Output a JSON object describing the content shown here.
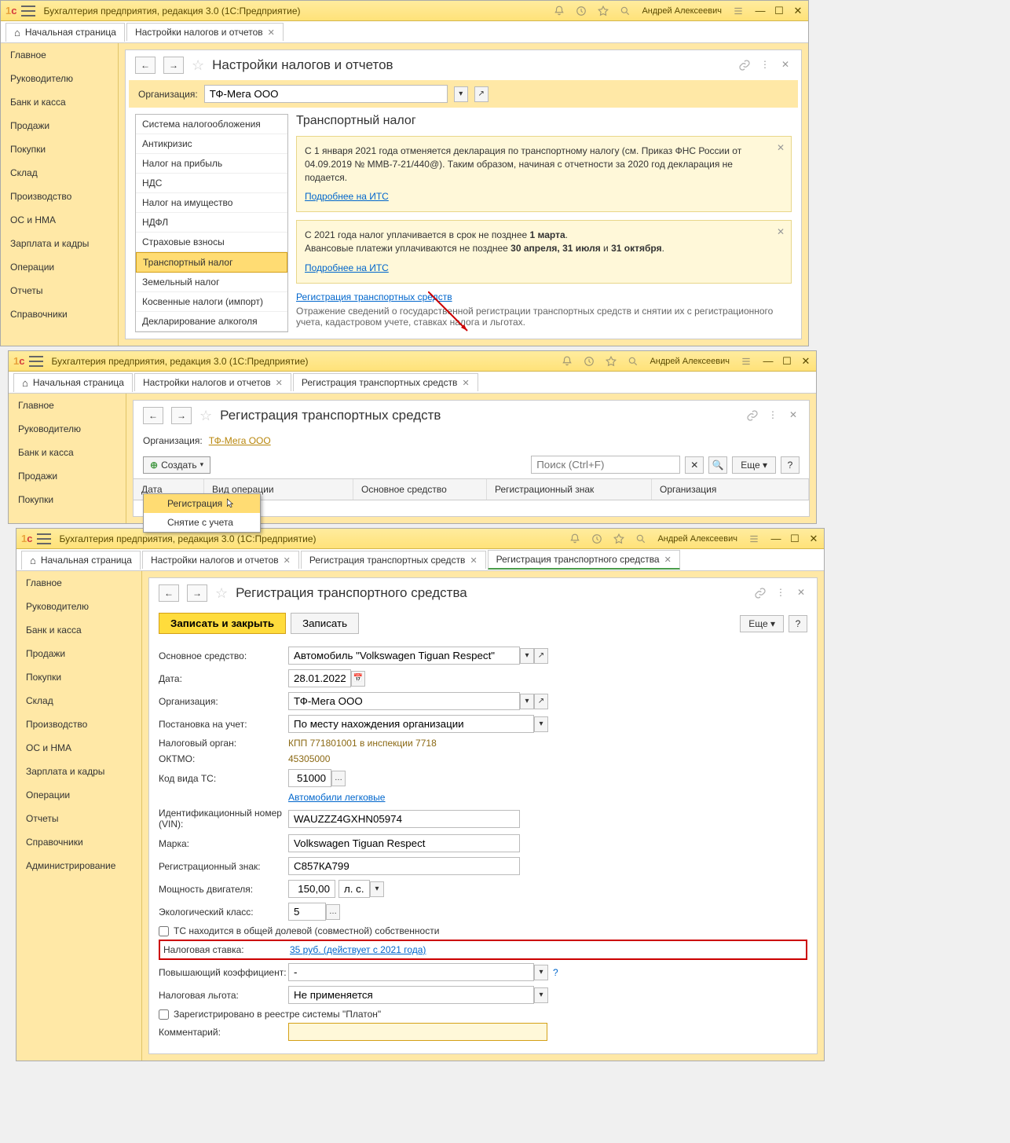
{
  "win1": {
    "title": "Бухгалтерия предприятия, редакция 3.0  (1С:Предприятие)",
    "user": "Андрей Алексеевич",
    "tabs": {
      "home": "Начальная страница",
      "t1": "Настройки налогов и отчетов"
    },
    "page_title": "Настройки налогов и отчетов",
    "org_label": "Организация:",
    "org_value": "ТФ-Мега ООО",
    "leftnav": [
      "Система налогообложения",
      "Антикризис",
      "Налог на прибыль",
      "НДС",
      "Налог на имущество",
      "НДФЛ",
      "Страховые взносы",
      "Транспортный налог",
      "Земельный налог",
      "Косвенные налоги (импорт)",
      "Декларирование алкоголя"
    ],
    "section_title": "Транспортный налог",
    "note1_a": "С 1 января 2021 года отменяется декларация по транспортному налогу (см. Приказ ФНС России от 04.09.2019 № ММВ-7-21/440@). Таким образом, начиная с отчетности за 2020 год декларация не подается.",
    "note1_link": "Подробнее на ИТС",
    "note2_a": "С 2021 года налог уплачивается в срок не позднее ",
    "note2_b": "1 марта",
    "note2_c": "Авансовые платежи уплачиваются не позднее ",
    "note2_d": "30 апреля, 31 июля",
    "note2_e": " и ",
    "note2_f": "31 октября",
    "note2_link": "Подробнее на ИТС",
    "reg_link": "Регистрация транспортных средств",
    "reg_desc": "Отражение сведений о государственной регистрации транспортных средств и снятии их с регистрационного учета, кадастровом учете, ставках налога и льготах."
  },
  "sidebar_items": [
    "Главное",
    "Руководителю",
    "Банк и касса",
    "Продажи",
    "Покупки",
    "Склад",
    "Производство",
    "ОС и НМА",
    "Зарплата и кадры",
    "Операции",
    "Отчеты",
    "Справочники",
    "Администрирование"
  ],
  "win2": {
    "title": "Бухгалтерия предприятия, редакция 3.0  (1С:Предприятие)",
    "user": "Андрей Алексеевич",
    "tabs": {
      "home": "Начальная страница",
      "t1": "Настройки налогов и отчетов",
      "t2": "Регистрация транспортных средств"
    },
    "page_title": "Регистрация транспортных средств",
    "org_label": "Организация:",
    "org_value": "ТФ-Мега ООО",
    "create": "Создать",
    "menu_reg": "Регистрация",
    "menu_unreg": "Снятие с учета",
    "search_ph": "Поиск (Ctrl+F)",
    "more": "Еще",
    "columns": [
      "Дата",
      "Вид операции",
      "Основное средство",
      "Регистрационный знак",
      "Организация"
    ]
  },
  "win3": {
    "title": "Бухгалтерия предприятия, редакция 3.0  (1С:Предприятие)",
    "user": "Андрей Алексеевич",
    "tabs": {
      "home": "Начальная страница",
      "t1": "Настройки налогов и отчетов",
      "t2": "Регистрация транспортных средств",
      "t3": "Регистрация транспортного средства"
    },
    "page_title": "Регистрация транспортного средства",
    "save_close": "Записать и закрыть",
    "save": "Записать",
    "more": "Еще",
    "fields": {
      "asset_l": "Основное средство:",
      "asset_v": "Автомобиль \"Volkswagen Tiguan Respect\"",
      "date_l": "Дата:",
      "date_v": "28.01.2022",
      "org_l": "Организация:",
      "org_v": "ТФ-Мега ООО",
      "reg_l": "Постановка на учет:",
      "reg_v": "По месту нахождения организации",
      "tax_auth_l": "Налоговый орган:",
      "tax_auth_v": "КПП 771801001 в инспекции 7718",
      "oktmo_l": "ОКТМО:",
      "oktmo_v": "45305000",
      "code_l": "Код вида ТС:",
      "code_v": "51000",
      "code_link": "Автомобили легковые",
      "vin_l": "Идентификационный номер (VIN):",
      "vin_v": "WAUZZZ4GXHN05974",
      "brand_l": "Марка:",
      "brand_v": "Volkswagen Tiguan Respect",
      "plate_l": "Регистрационный знак:",
      "plate_v": "С857КА799",
      "power_l": "Мощность двигателя:",
      "power_v": "150,00",
      "power_unit": "л. с.",
      "eco_l": "Экологический класс:",
      "eco_v": "5",
      "shared_cb": "ТС находится в общей долевой (совместной) собственности",
      "rate_l": "Налоговая ставка:",
      "rate_v": "35 руб. (действует с 2021 года)",
      "coef_l": "Повышающий коэффициент:",
      "coef_v": "-",
      "benefit_l": "Налоговая льгота:",
      "benefit_v": "Не применяется",
      "platon_cb": "Зарегистрировано в реестре системы \"Платон\"",
      "comment_l": "Комментарий:"
    }
  }
}
